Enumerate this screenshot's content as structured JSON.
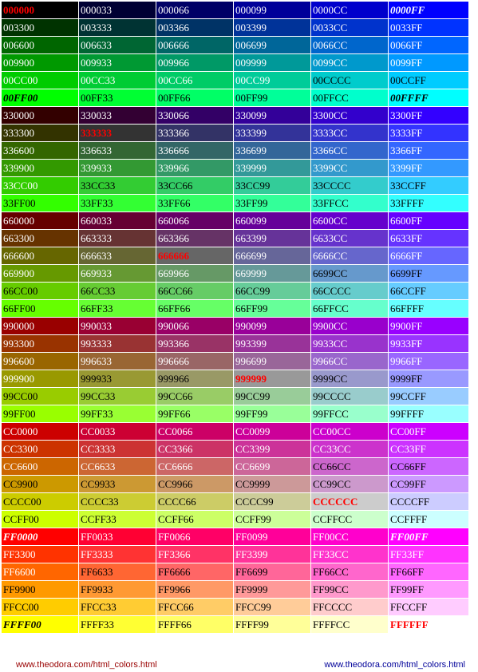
{
  "grid": {
    "rows": [
      [
        "000000",
        "000033",
        "000066",
        "000099",
        "0000CC",
        "0000FF"
      ],
      [
        "003300",
        "003333",
        "003366",
        "003399",
        "0033CC",
        "0033FF"
      ],
      [
        "006600",
        "006633",
        "006666",
        "006699",
        "0066CC",
        "0066FF"
      ],
      [
        "009900",
        "009933",
        "009966",
        "009999",
        "0099CC",
        "0099FF"
      ],
      [
        "00CC00",
        "00CC33",
        "00CC66",
        "00CC99",
        "00CCCC",
        "00CCFF"
      ],
      [
        "00FF00",
        "00FF33",
        "00FF66",
        "00FF99",
        "00FFCC",
        "00FFFF"
      ],
      [
        "330000",
        "330033",
        "330066",
        "330099",
        "3300CC",
        "3300FF"
      ],
      [
        "333300",
        "333333",
        "333366",
        "333399",
        "3333CC",
        "3333FF"
      ],
      [
        "336600",
        "336633",
        "336666",
        "336699",
        "3366CC",
        "3366FF"
      ],
      [
        "339900",
        "339933",
        "339966",
        "339999",
        "3399CC",
        "3399FF"
      ],
      [
        "33CC00",
        "33CC33",
        "33CC66",
        "33CC99",
        "33CCCC",
        "33CCFF"
      ],
      [
        "33FF00",
        "33FF33",
        "33FF66",
        "33FF99",
        "33FFCC",
        "33FFFF"
      ],
      [
        "660000",
        "660033",
        "660066",
        "660099",
        "6600CC",
        "6600FF"
      ],
      [
        "663300",
        "663333",
        "663366",
        "663399",
        "6633CC",
        "6633FF"
      ],
      [
        "666600",
        "666633",
        "666666",
        "666699",
        "6666CC",
        "6666FF"
      ],
      [
        "669900",
        "669933",
        "669966",
        "669999",
        "6699CC",
        "6699FF"
      ],
      [
        "66CC00",
        "66CC33",
        "66CC66",
        "66CC99",
        "66CCCC",
        "66CCFF"
      ],
      [
        "66FF00",
        "66FF33",
        "66FF66",
        "66FF99",
        "66FFCC",
        "66FFFF"
      ],
      [
        "990000",
        "990033",
        "990066",
        "990099",
        "9900CC",
        "9900FF"
      ],
      [
        "993300",
        "993333",
        "993366",
        "993399",
        "9933CC",
        "9933FF"
      ],
      [
        "996600",
        "996633",
        "996666",
        "996699",
        "9966CC",
        "9966FF"
      ],
      [
        "999900",
        "999933",
        "999966",
        "999999",
        "9999CC",
        "9999FF"
      ],
      [
        "99CC00",
        "99CC33",
        "99CC66",
        "99CC99",
        "99CCCC",
        "99CCFF"
      ],
      [
        "99FF00",
        "99FF33",
        "99FF66",
        "99FF99",
        "99FFCC",
        "99FFFF"
      ],
      [
        "CC0000",
        "CC0033",
        "CC0066",
        "CC0099",
        "CC00CC",
        "CC00FF"
      ],
      [
        "CC3300",
        "CC3333",
        "CC3366",
        "CC3399",
        "CC33CC",
        "CC33FF"
      ],
      [
        "CC6600",
        "CC6633",
        "CC6666",
        "CC6699",
        "CC66CC",
        "CC66FF"
      ],
      [
        "CC9900",
        "CC9933",
        "CC9966",
        "CC9999",
        "CC99CC",
        "CC99FF"
      ],
      [
        "CCCC00",
        "CCCC33",
        "CCCC66",
        "CCCC99",
        "CCCCCC",
        "CCCCFF"
      ],
      [
        "CCFF00",
        "CCFF33",
        "CCFF66",
        "CCFF99",
        "CCFFCC",
        "CCFFFF"
      ],
      [
        "FF0000",
        "FF0033",
        "FF0066",
        "FF0099",
        "FF00CC",
        "FF00FF"
      ],
      [
        "FF3300",
        "FF3333",
        "FF3366",
        "FF3399",
        "FF33CC",
        "FF33FF"
      ],
      [
        "FF6600",
        "FF6633",
        "FF6666",
        "FF6699",
        "FF66CC",
        "FF66FF"
      ],
      [
        "FF9900",
        "FF9933",
        "FF9966",
        "FF9999",
        "FF99CC",
        "FF99FF"
      ],
      [
        "FFCC00",
        "FFCC33",
        "FFCC66",
        "FFCC99",
        "FFCCCC",
        "FFCCFF"
      ],
      [
        "FFFF00",
        "FFFF33",
        "FFFF66",
        "FFFF99",
        "FFFFCC",
        "FFFFFF"
      ]
    ],
    "red_highlight": [
      "000000",
      "333333",
      "666666",
      "999999",
      "CCCCCC",
      "FFFFFF"
    ],
    "bold_italic": [
      "0000FF",
      "00FF00",
      "00FFFF",
      "FF0000",
      "FF00FF",
      "FFFF00"
    ],
    "red_color": "#ff0000"
  },
  "footer": {
    "left": "www.theodora.com/html_colors.html",
    "right": "www.theodora.com/html_colors.html",
    "left_color": "#990000",
    "right_color": "#000099"
  }
}
